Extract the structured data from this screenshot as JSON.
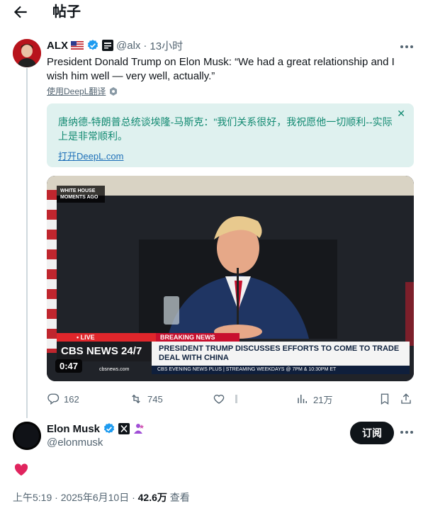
{
  "page": {
    "title": "帖子"
  },
  "tweet": {
    "author_name": "ALX",
    "handle": "@alx",
    "time": "13小时",
    "text": "President Donald Trump on Elon Musk: “We had a great relationship and I wish him well — very well, actually.”",
    "translate_label": "使用DeepL翻译",
    "translation": {
      "text": "唐纳德-特朗普总统谈埃隆-马斯克：\"我们关系很好，我祝愿他一切顺利--实际上是非常顺利。",
      "link": "打开DeepL.com"
    },
    "video": {
      "duration": "0:47",
      "overlay_corner": "WHITE HOUSE MOMENTS AGO",
      "live_label": "• LIVE",
      "breaking_label": "BREAKING NEWS",
      "network_label": "CBS NEWS 24/7",
      "headline": "PRESIDENT TRUMP DISCUSSES EFFORTS TO COME TO TRADE DEAL WITH CHINA",
      "ticker": "CBS EVENING NEWS PLUS | STREAMING WEEKDAYS @ 7PM & 10:30PM ET",
      "domain": "cbsnews.com"
    },
    "stats": {
      "replies": "162",
      "retweets": "745",
      "views": "21万"
    }
  },
  "reply": {
    "author_name": "Elon Musk",
    "handle": "@elonmusk",
    "follow_label": "订阅"
  },
  "footer": {
    "time": "上午5:19 · 2025年6月10日 · ",
    "views": "42.6万",
    "views_label": " 查看"
  },
  "colors": {
    "verified_blue": "#1d9bf0",
    "translation_bg": "#dff1ef",
    "translation_text": "#138a72",
    "heart": "#e0245e"
  }
}
